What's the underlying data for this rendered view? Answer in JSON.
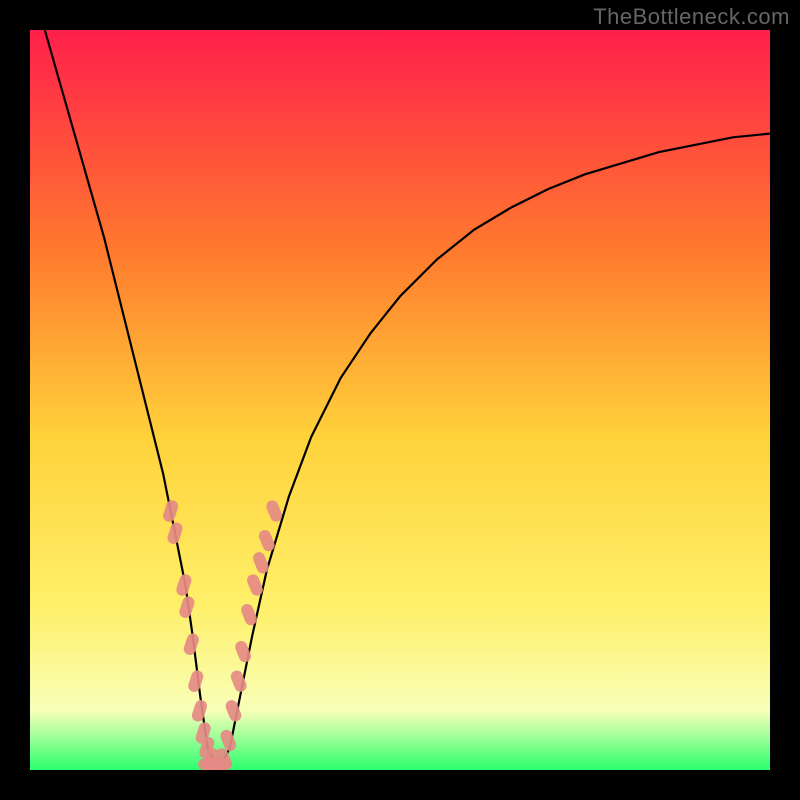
{
  "watermark": "TheBottleneck.com",
  "colors": {
    "frame": "#000000",
    "gradient_top": "#ff1f4b",
    "gradient_mid_upper": "#ff7a2e",
    "gradient_mid": "#ffd23a",
    "gradient_mid_lower": "#fff06a",
    "gradient_pale": "#f8ffb8",
    "gradient_green": "#2bff6e",
    "curve": "#000000",
    "marker": "#e58a84"
  },
  "chart_data": {
    "type": "line",
    "title": "",
    "xlabel": "",
    "ylabel": "",
    "xlim": [
      0,
      100
    ],
    "ylim": [
      0,
      100
    ],
    "series": [
      {
        "name": "bottleneck-curve",
        "x": [
          2,
          4,
          6,
          8,
          10,
          12,
          14,
          16,
          18,
          20,
          21,
          22,
          23,
          24,
          25,
          26,
          27,
          28,
          30,
          32,
          35,
          38,
          42,
          46,
          50,
          55,
          60,
          65,
          70,
          75,
          80,
          85,
          90,
          95,
          100
        ],
        "y": [
          100,
          93,
          86,
          79,
          72,
          64,
          56,
          48,
          40,
          30,
          25,
          18,
          10,
          3,
          1,
          1,
          3,
          8,
          18,
          27,
          37,
          45,
          53,
          59,
          64,
          69,
          73,
          76,
          78.5,
          80.5,
          82,
          83.5,
          84.5,
          85.5,
          86
        ]
      }
    ],
    "scatter": [
      {
        "name": "markers-left",
        "x": [
          19.0,
          19.6,
          20.8,
          21.2,
          21.8,
          22.4,
          22.9,
          23.4,
          23.9,
          24.5
        ],
        "y": [
          35,
          32,
          25,
          22,
          17,
          12,
          8,
          5,
          3,
          1.5
        ]
      },
      {
        "name": "markers-right",
        "x": [
          26.2,
          26.8,
          27.5,
          28.2,
          28.8,
          29.6,
          30.4,
          31.2,
          32.0,
          33.0
        ],
        "y": [
          1.5,
          4,
          8,
          12,
          16,
          21,
          25,
          28,
          31,
          35
        ]
      },
      {
        "name": "markers-bottom",
        "x": [
          24.2,
          25.0,
          25.8
        ],
        "y": [
          0.8,
          0.6,
          0.8
        ]
      }
    ]
  }
}
